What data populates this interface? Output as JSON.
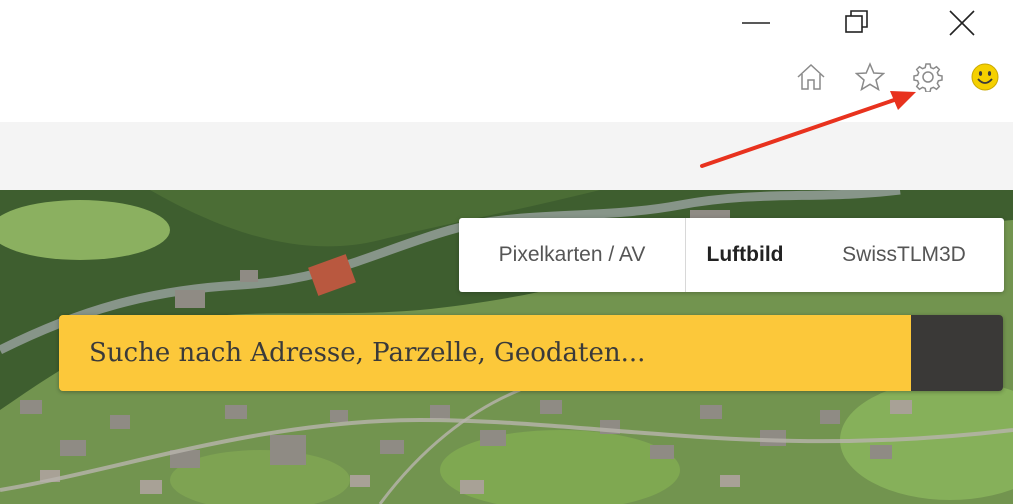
{
  "window_controls": {
    "minimize_icon": "minimize-icon",
    "restore_icon": "restore-icon",
    "close_icon": "close-icon"
  },
  "toolbar": {
    "icons": [
      "home-icon",
      "star-icon",
      "gear-icon",
      "smiley-icon"
    ]
  },
  "layer_switcher": {
    "tabs": [
      {
        "label": "Pixelkarten / AV",
        "active": false
      },
      {
        "label": "Luftbild",
        "active": true
      },
      {
        "label": "SwissTLM3D",
        "active": false
      }
    ]
  },
  "search": {
    "placeholder": "Suche nach Adresse, Parzelle, Geodaten...",
    "value": "",
    "button_icon": "search-icon"
  },
  "colors": {
    "search_field": "#fcc83a",
    "search_button": "#3a3937",
    "annotation_arrow": "#e8321e"
  }
}
